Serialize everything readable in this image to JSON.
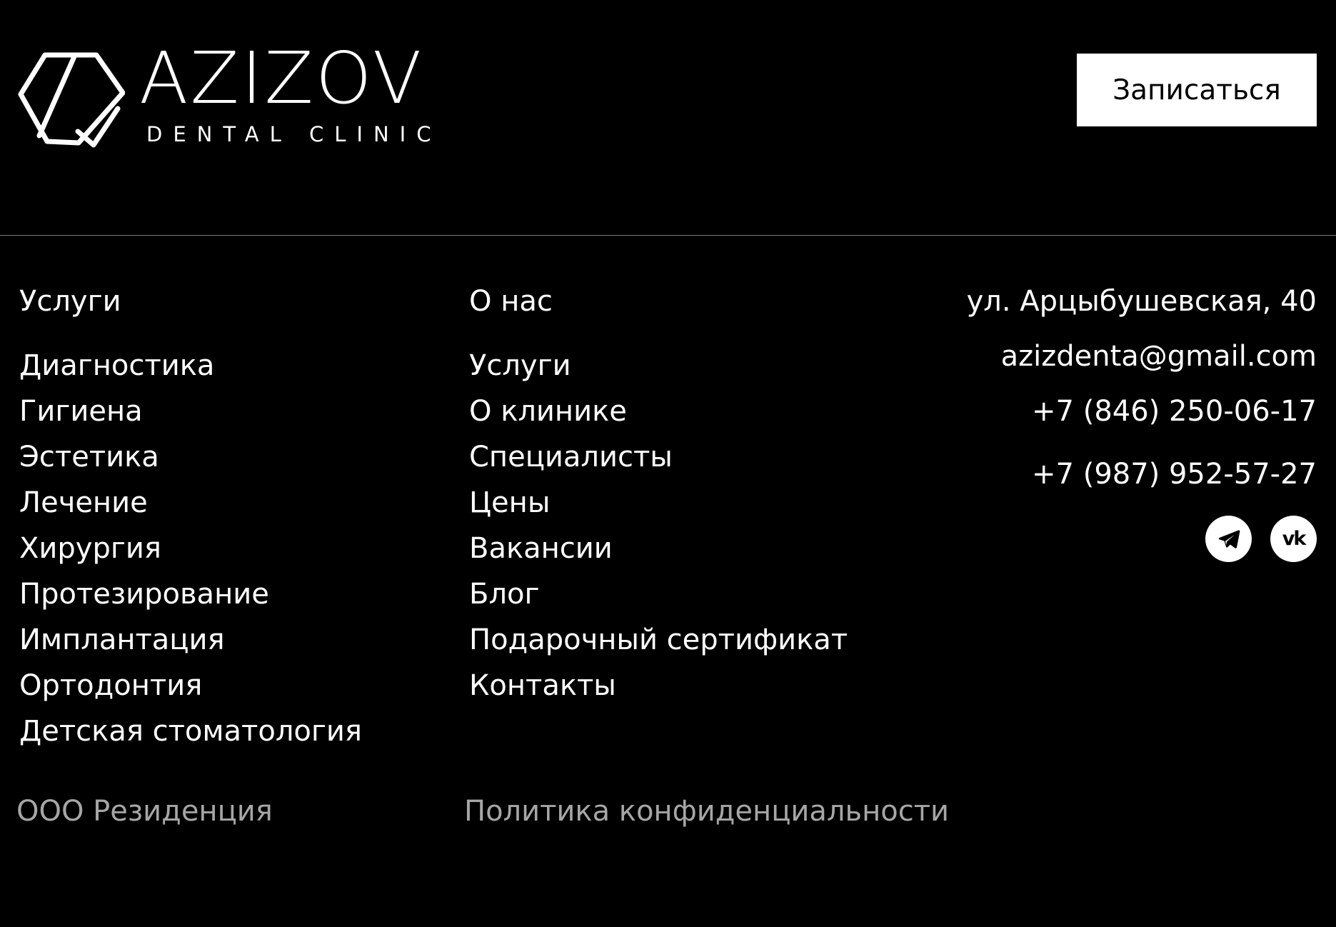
{
  "brand": {
    "name": "AZIZOV",
    "tagline": "DENTAL CLINIC"
  },
  "header": {
    "cta_label": "Записаться"
  },
  "services_column": {
    "heading": "Услуги",
    "items": [
      "Диагностика",
      "Гигиена",
      "Эстетика",
      "Лечение",
      "Хирургия",
      "Протезирование",
      "Имплантация",
      "Ортодонтия",
      "Детская стоматология"
    ]
  },
  "about_column": {
    "heading": "О нас",
    "items": [
      "Услуги",
      "О клинике",
      "Специалисты",
      "Цены",
      "Вакансии",
      "Блог",
      "Подарочный сертификат",
      "Контакты"
    ]
  },
  "contacts": {
    "address": "ул. Арцыбушевская, 40",
    "email": "azizdenta@gmail.com",
    "phone_1": "+7 (846) 250-06-17",
    "phone_2": "+7 (987) 952-57-27",
    "socials": [
      {
        "icon": "telegram-icon"
      },
      {
        "icon": "vk-icon",
        "glyph": "vk"
      }
    ]
  },
  "footer": {
    "company": "ООО Резиденция",
    "privacy_label": "Политика конфиденциальности"
  },
  "colors": {
    "background": "#000000",
    "text": "#ffffff",
    "muted_text": "#a6a6a6",
    "divider": "#7a7a7a",
    "button_bg": "#ffffff",
    "button_text": "#000000"
  }
}
